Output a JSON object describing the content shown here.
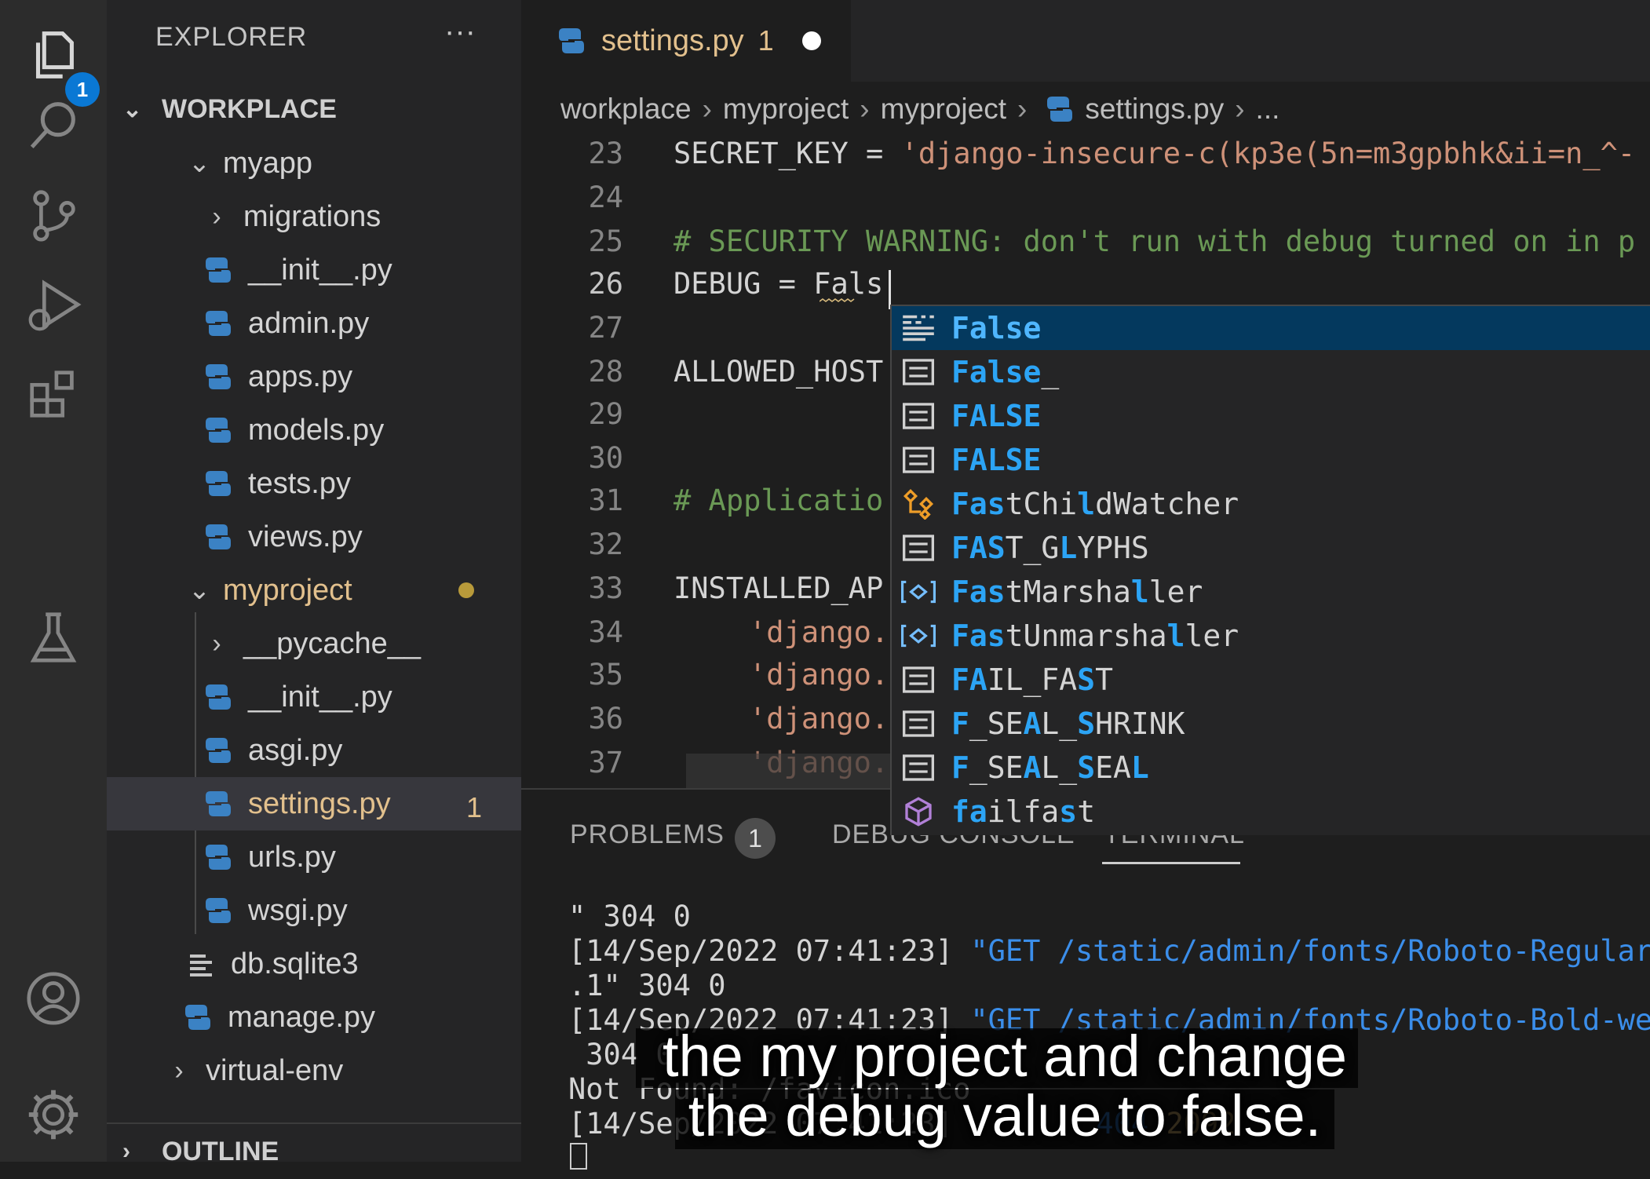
{
  "explorer": {
    "title": "EXPLORER",
    "more": "···",
    "workspace": "WORKPLACE",
    "outline": "OUTLINE",
    "items": [
      {
        "label": "myapp",
        "kind": "folder-open"
      },
      {
        "label": "migrations",
        "kind": "folder"
      },
      {
        "label": "__init__.py",
        "kind": "py"
      },
      {
        "label": "admin.py",
        "kind": "py"
      },
      {
        "label": "apps.py",
        "kind": "py"
      },
      {
        "label": "models.py",
        "kind": "py"
      },
      {
        "label": "tests.py",
        "kind": "py"
      },
      {
        "label": "views.py",
        "kind": "py"
      },
      {
        "label": "myproject",
        "kind": "folder-open"
      },
      {
        "label": "__pycache__",
        "kind": "folder"
      },
      {
        "label": "__init__.py",
        "kind": "py"
      },
      {
        "label": "asgi.py",
        "kind": "py"
      },
      {
        "label": "settings.py",
        "kind": "py",
        "count": "1"
      },
      {
        "label": "urls.py",
        "kind": "py"
      },
      {
        "label": "wsgi.py",
        "kind": "py"
      },
      {
        "label": "db.sqlite3",
        "kind": "db"
      },
      {
        "label": "manage.py",
        "kind": "py"
      },
      {
        "label": "virtual-env",
        "kind": "folder"
      }
    ]
  },
  "activity": {
    "explorer_badge": "1",
    "icons": [
      "files-icon",
      "search-icon",
      "source-control-icon",
      "run-debug-icon",
      "extensions-icon",
      "testing-icon",
      "account-icon",
      "settings-gear-icon"
    ]
  },
  "tab": {
    "label": "settings.py",
    "count": "1"
  },
  "breadcrumb": {
    "parts": [
      "workplace",
      "myproject",
      "myproject",
      "settings.py",
      "..."
    ]
  },
  "editor": {
    "line_numbers": [
      "23",
      "24",
      "25",
      "26",
      "27",
      "28",
      "29",
      "30",
      "31",
      "32",
      "33",
      "34",
      "35",
      "36",
      "37"
    ],
    "lines": {
      "l23_a": "SECRET_KEY = ",
      "l23_b": "'django-insecure-c(kp3e(5n=m3gpbhk&ii=n_^-",
      "l25": "# SECURITY WARNING: don't run with debug turned on in p",
      "l26_a": "DEBUG = ",
      "l26_b": "Fals",
      "l28": "ALLOWED_HOST",
      "l31": "# Applicatio",
      "l33": "INSTALLED_AP",
      "l34": "'django.",
      "l35": "'django.",
      "l36": "'django.",
      "l37": "'django."
    }
  },
  "suggestions": [
    {
      "pre": "False",
      "post": "",
      "icon": "keyword-icon"
    },
    {
      "pre": "False",
      "post": "_",
      "icon": "variable-icon"
    },
    {
      "pre": "FALSE",
      "post": "",
      "icon": "variable-icon"
    },
    {
      "pre": "FALSE",
      "post": "",
      "icon": "variable-icon"
    },
    {
      "pre": "Fa",
      "mid": "st",
      "hl2": "C",
      "mid2": "hi",
      "hl3": "l",
      "post": "dWatcher",
      "full": "FastChildWatcher",
      "icon": "class-icon"
    },
    {
      "full": "FAST_GLYPHS",
      "icon": "variable-icon"
    },
    {
      "full": "FastMarshaller",
      "icon": "field-icon"
    },
    {
      "full": "FastUnmarshaller",
      "icon": "field-icon"
    },
    {
      "full": "FAIL_FAST",
      "icon": "variable-icon"
    },
    {
      "full": "F_SEAL_SHRINK",
      "icon": "variable-icon"
    },
    {
      "full": "F_SEAL_SEAL",
      "icon": "variable-icon"
    },
    {
      "full": "failfast",
      "icon": "method-icon"
    }
  ],
  "panel": {
    "tabs": [
      "PROBLEMS",
      "DEBUG CONSOLE",
      "TERMINAL"
    ],
    "problems_count": "1",
    "terminal": {
      "t1": "\" 304 0",
      "t2a": "[14/Sep/2022 07:41:23] ",
      "t2b": "\"GET /static/admin/fonts/Roboto-Regular-w",
      "t3": ".1\" 304 0",
      "t4a": "[14/Sep/2022 07:41:23] ",
      "t4b": "\"GET /static/admin/fonts/Roboto-Bold-webf",
      "t5": " 304 0",
      "t6": "Not Found: /favicon.ico",
      "t7a": "[14/Sep/2022 07:41:23] ",
      "t7b": "404 ",
      "t7c": "2092"
    }
  },
  "caption": {
    "line1": "the my project and change",
    "line2": "the debug value to false."
  },
  "colors": {
    "accent": "#0a78d4",
    "modified": "#e2c08d",
    "suggest_match": "#2ca4f5"
  }
}
